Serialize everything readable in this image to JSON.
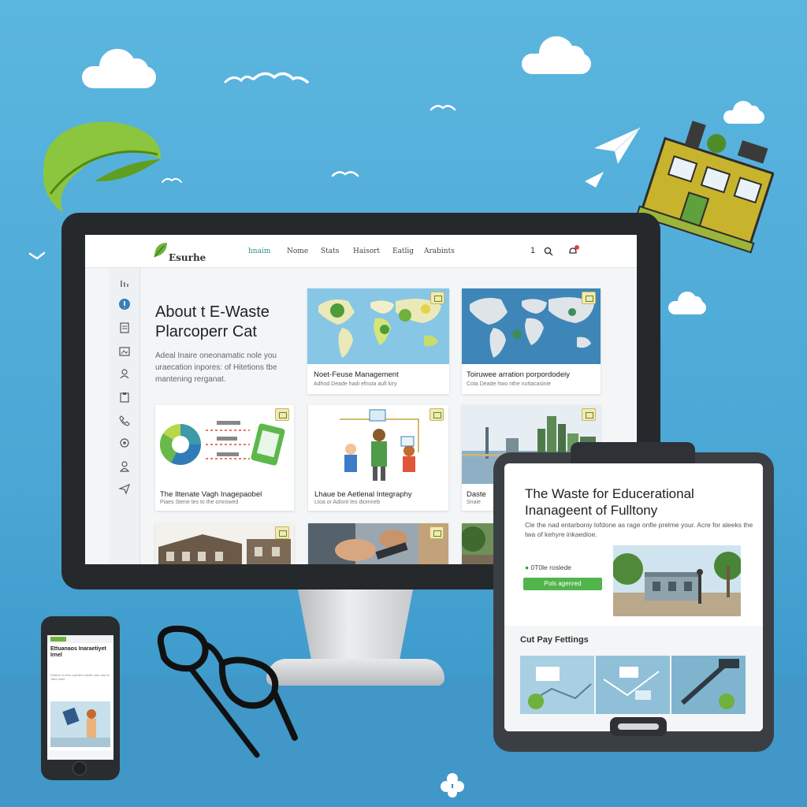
{
  "site": {
    "logo_text": "Esurhe",
    "nav": [
      "hnaim",
      "Nome",
      "Stats",
      "Haisort",
      "Eatlig",
      "Arabints"
    ],
    "header_number": "1"
  },
  "hero": {
    "title": "About t E-Waste Plarcoperr Cat",
    "description": "Adeal Inaire oneonamatic nole you uraecation inpores: of Hitetions tbe mantening rerganat."
  },
  "cards": [
    {
      "title": "Noet-Feuse Management",
      "sub": "Adhod Deade hadi efnuta aufi kiry"
    },
    {
      "title": "Toiruwee arration porpordodeiy",
      "sub": "Cota Deade hwo nthe nuttacasinie"
    },
    {
      "title": "The Iltenate Vagh Inagepaobel",
      "sub": "Piaes Stene tes to the omrowed"
    },
    {
      "title": "Lhaue be Aetlenal Integraphy",
      "sub": "Ltoa or Adiont leo diomneb"
    },
    {
      "title": "Daste",
      "sub": "Snaie"
    }
  ],
  "tablet": {
    "title": "The Waste for Educerational Inanageent of Fulltony",
    "description": "Cle the nad entarboniy lofdone as rage onfie prelme your. Acre for aleeks the twa of kehyre inkaedioe.",
    "stat": "0T0le roslede",
    "button": "Pols agenred",
    "section_title": "Cut Pay Fettings"
  },
  "phone": {
    "title": "Ettuanaos Inaraetiyet Irnel",
    "description": "Dialrne ol meb voanlies inesbt oran obu ta Tahe ontle"
  }
}
